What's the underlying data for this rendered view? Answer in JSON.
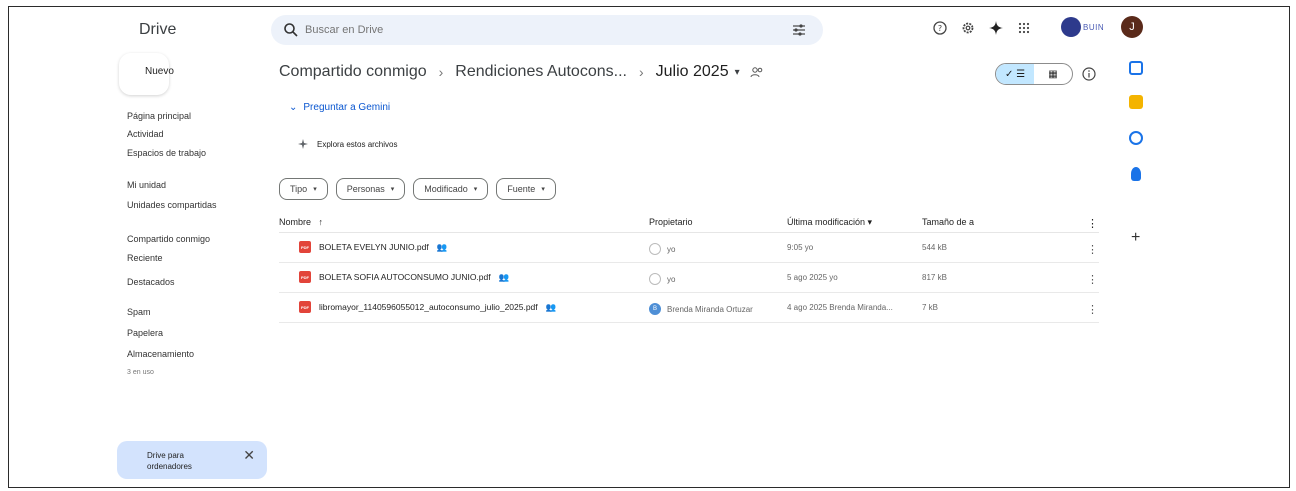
{
  "app": {
    "title": "Drive"
  },
  "search": {
    "placeholder": "Buscar en Drive"
  },
  "header": {
    "org_text": "BUIN",
    "avatar_initial": "J"
  },
  "sidebar": {
    "new_label": "Nuevo",
    "items": [
      {
        "label": "Página principal"
      },
      {
        "label": "Actividad"
      },
      {
        "label": "Espacios de trabajo"
      },
      {
        "label": "Mi unidad"
      },
      {
        "label": "Unidades compartidas"
      },
      {
        "label": "Compartido conmigo"
      },
      {
        "label": "Reciente"
      },
      {
        "label": "Destacados"
      },
      {
        "label": "Spam"
      },
      {
        "label": "Papelera"
      },
      {
        "label": "Almacenamiento"
      }
    ],
    "storage_text": "3 en uso",
    "promo": {
      "text": "Drive para ordenadores"
    }
  },
  "breadcrumb": {
    "items": [
      "Compartido conmigo",
      "Rendiciones Autocons..."
    ],
    "current": "Julio 2025"
  },
  "gemini": {
    "label": "Preguntar a Gemini",
    "explore_label": "Explora estos archivos"
  },
  "filters": [
    "Tipo",
    "Personas",
    "Modificado",
    "Fuente"
  ],
  "table": {
    "headers": {
      "name": "Nombre",
      "owner": "Propietario",
      "modified": "Última modificación",
      "size": "Tamaño de a"
    },
    "rows": [
      {
        "name": "BOLETA EVELYN JUNIO.pdf",
        "owner": "yo",
        "modified": "9:05 yo",
        "size": "544 kB"
      },
      {
        "name": "BOLETA SOFIA AUTOCONSUMO JUNIO.pdf",
        "owner": "yo",
        "modified": "5 ago 2025 yo",
        "size": "817 kB"
      },
      {
        "name": "libromayor_1140596055012_autoconsumo_julio_2025.pdf",
        "owner": "Brenda Miranda Ortuzar",
        "owner_initial": "B",
        "modified": "4 ago 2025 Brenda Miranda...",
        "size": "7 kB"
      }
    ]
  },
  "colors": {
    "accent": "#0b57d0",
    "search_bg": "#edf2fa",
    "toggle_active": "#c2e7ff",
    "pdf_red": "#e2443a"
  }
}
